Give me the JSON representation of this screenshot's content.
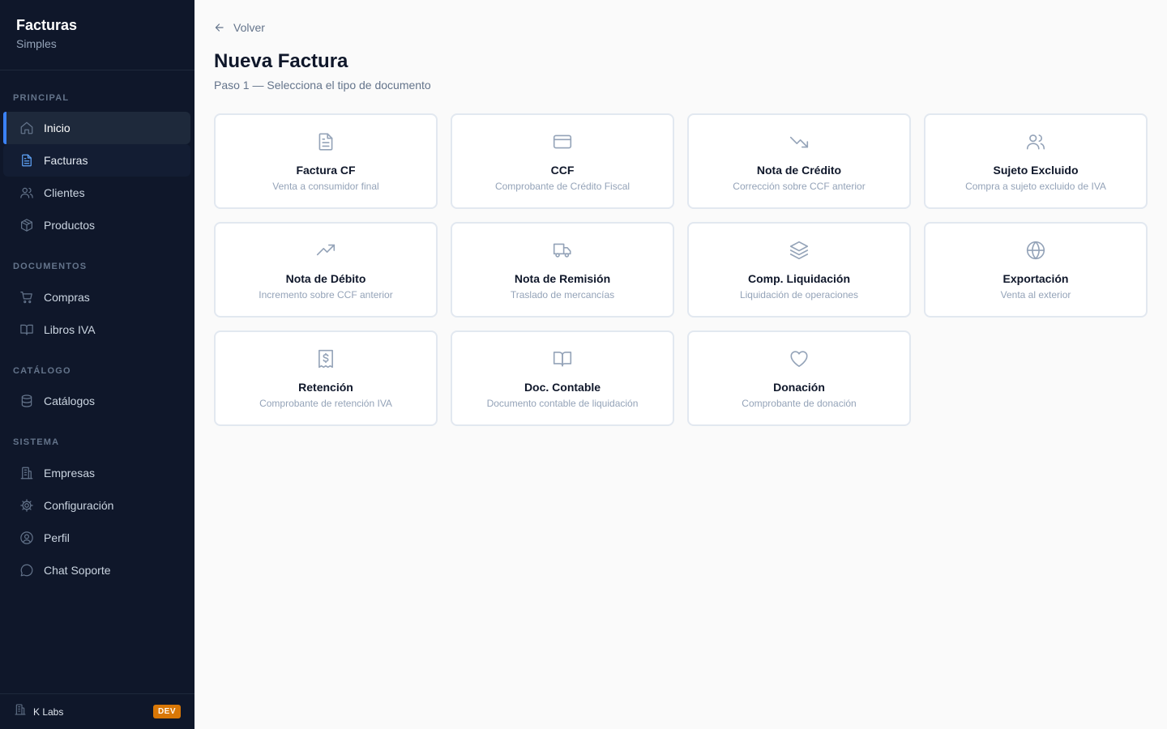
{
  "brand": {
    "title": "Facturas",
    "subtitle": "Simples"
  },
  "sidebar": {
    "sections": [
      {
        "label": "PRINCIPAL"
      },
      {
        "label": "DOCUMENTOS"
      },
      {
        "label": "CATÁLOGO"
      },
      {
        "label": "SISTEMA"
      }
    ],
    "items": [
      {
        "label": "Inicio",
        "icon": "home-icon"
      },
      {
        "label": "Facturas",
        "icon": "file-text-icon"
      },
      {
        "label": "Clientes",
        "icon": "users-icon"
      },
      {
        "label": "Productos",
        "icon": "box-icon"
      },
      {
        "label": "Compras",
        "icon": "cart-icon"
      },
      {
        "label": "Libros IVA",
        "icon": "book-icon"
      },
      {
        "label": "Catálogos",
        "icon": "database-icon"
      },
      {
        "label": "Empresas",
        "icon": "building-icon"
      },
      {
        "label": "Configuración",
        "icon": "gear-icon"
      },
      {
        "label": "Perfil",
        "icon": "user-circle-icon"
      },
      {
        "label": "Chat Soporte",
        "icon": "chat-icon"
      }
    ]
  },
  "footer": {
    "name": "K Labs",
    "badge": "DEV",
    "badge_color": "#d97706"
  },
  "header": {
    "back_label": "Volver",
    "title": "Nueva Factura",
    "subtitle": "Paso 1 — Selecciona el tipo de documento"
  },
  "cards": [
    {
      "title": "Factura CF",
      "desc": "Venta a consumidor final",
      "icon": "file-text-icon"
    },
    {
      "title": "CCF",
      "desc": "Comprobante de Crédito Fiscal",
      "icon": "credit-card-icon"
    },
    {
      "title": "Nota de Crédito",
      "desc": "Corrección sobre CCF anterior",
      "icon": "trending-down-icon"
    },
    {
      "title": "Sujeto Excluido",
      "desc": "Compra a sujeto excluido de IVA",
      "icon": "users-icon"
    },
    {
      "title": "Nota de Débito",
      "desc": "Incremento sobre CCF anterior",
      "icon": "trending-up-icon"
    },
    {
      "title": "Nota de Remisión",
      "desc": "Traslado de mercancías",
      "icon": "truck-icon"
    },
    {
      "title": "Comp. Liquidación",
      "desc": "Liquidación de operaciones",
      "icon": "layers-icon"
    },
    {
      "title": "Exportación",
      "desc": "Venta al exterior",
      "icon": "globe-icon"
    },
    {
      "title": "Retención",
      "desc": "Comprobante de retención IVA",
      "icon": "receipt-icon"
    },
    {
      "title": "Doc. Contable",
      "desc": "Documento contable de liquidación",
      "icon": "book-open-icon"
    },
    {
      "title": "Donación",
      "desc": "Comprobante de donación",
      "icon": "heart-icon"
    }
  ],
  "colors": {
    "sidebar_bg": "#0f172a",
    "accent": "#3b82f6",
    "page_bg": "#fafafa"
  }
}
